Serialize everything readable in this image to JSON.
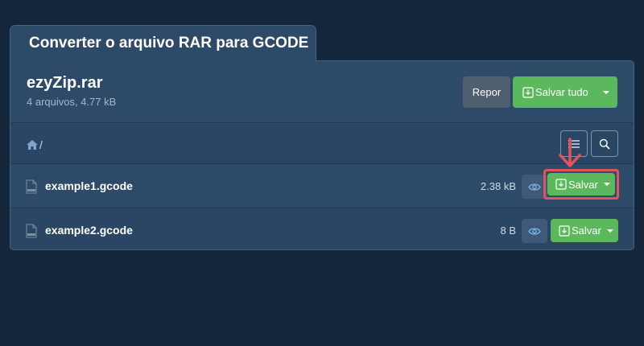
{
  "tab": {
    "title": "Converter o arquivo RAR para GCODE"
  },
  "archive": {
    "name": "ezyZip.rar",
    "meta": "4 arquivos, 4.77 kB",
    "reset_label": "Repor",
    "save_all_label": "Salvar tudo"
  },
  "path": {
    "separator": "/"
  },
  "files": [
    {
      "name": "example1.gcode",
      "size": "2.38 kB",
      "save_label": "Salvar"
    },
    {
      "name": "example2.gcode",
      "size": "8 B",
      "save_label": "Salvar"
    }
  ],
  "colors": {
    "background": "#13263a",
    "panel": "#2e4a69",
    "green": "#5cb85c",
    "highlight": "#e2545b"
  },
  "icons": [
    "download-icon",
    "chevron-down-icon",
    "home-icon",
    "list-icon",
    "search-icon",
    "eye-icon",
    "file-icon"
  ]
}
